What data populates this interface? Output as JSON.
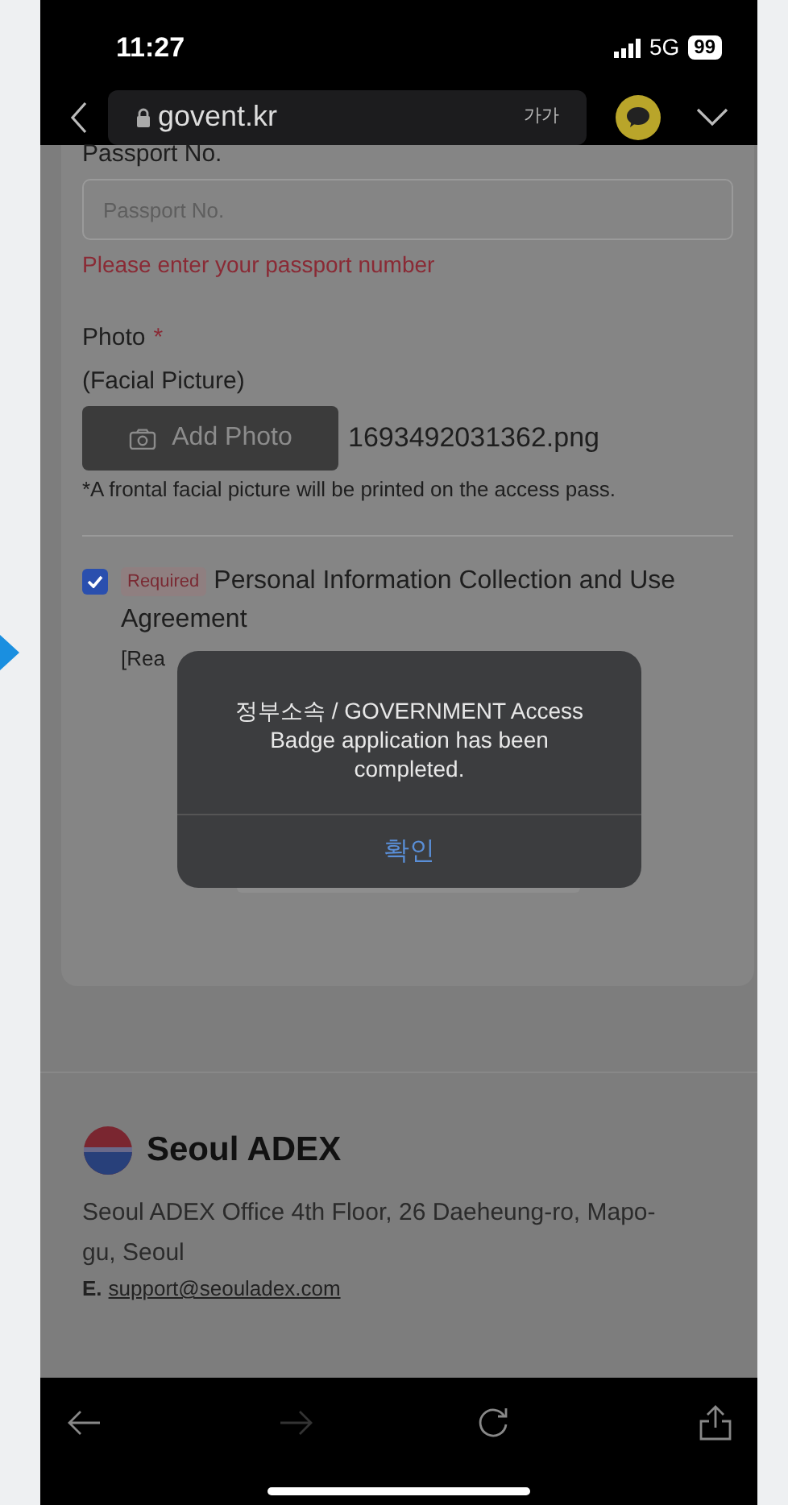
{
  "status_bar": {
    "time": "11:27",
    "network": "5G",
    "battery": "99"
  },
  "browser": {
    "url": "govent.kr",
    "text_size_button": "가가"
  },
  "form": {
    "passport": {
      "label": "Passport No.",
      "placeholder": "Passport No.",
      "error": "Please enter your passport number"
    },
    "photo": {
      "label": "Photo",
      "required_mark": "*",
      "sublabel": "(Facial Picture)",
      "button": "Add Photo",
      "file_name": "1693492031362.png",
      "note": "*A frontal facial picture will be printed on the access pass."
    },
    "agreement": {
      "checked": true,
      "badge": "Required",
      "label_lines": [
        "Personal Information Collection and Use",
        "Agreement"
      ],
      "link": "[Rea"
    }
  },
  "dialog": {
    "message": "정부소속 / GOVERNMENT Access Badge application has been completed.",
    "button": "확인"
  },
  "footer": {
    "brand": "Seoul ADEX",
    "address": "Seoul ADEX Office 4th Floor, 26 Daeheung-ro, Mapo-gu, Seoul",
    "email_label": "E.",
    "email": "support@seouladex.com"
  }
}
